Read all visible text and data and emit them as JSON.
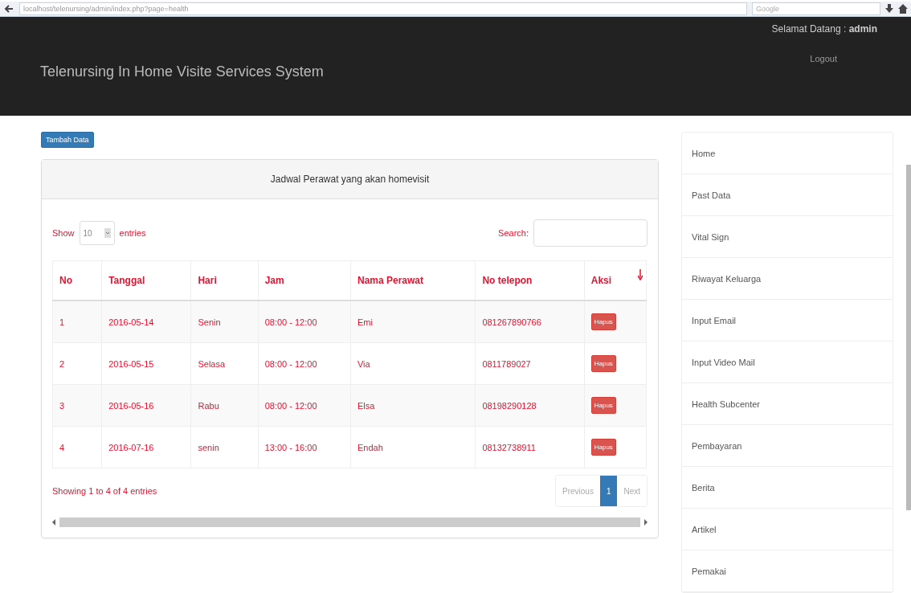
{
  "browser": {
    "url": "localhost/telenursing/admin/index.php?page=health",
    "search_placeholder": "Google"
  },
  "navbar": {
    "brand": "Telenursing In Home Visite Services System",
    "greeting": "Selamat Datang :",
    "user": "admin",
    "logout": "Logout"
  },
  "add_button": "Tambah Data",
  "panel": {
    "title": "Jadwal Perawat yang akan homevisit",
    "length": {
      "show": "Show",
      "value": "10",
      "entries": "entries"
    },
    "search": {
      "label": "Search:"
    },
    "table": {
      "columns": [
        "No",
        "Tanggal",
        "Hari",
        "Jam",
        "Nama Perawat",
        "No telepon",
        "Aksi"
      ],
      "rows": [
        {
          "cells": [
            "1",
            "2016-05-14",
            "Senin",
            "08:00 - 12:00",
            "Emi",
            "081267890766"
          ],
          "action": "Hapus"
        },
        {
          "cells": [
            "2",
            "2016-05-15",
            "Selasa",
            "08:00 - 12:00",
            "Via",
            "0811789027"
          ],
          "action": "Hapus"
        },
        {
          "cells": [
            "3",
            "2016-05-16",
            "Rabu",
            "08:00 - 12:00",
            "Elsa",
            "08198290128"
          ],
          "action": "Hapus"
        },
        {
          "cells": [
            "4",
            "2016-07-16",
            "senin",
            "13:00 - 16:00",
            "Endah",
            "08132738911"
          ],
          "action": "Hapus"
        }
      ]
    },
    "info": "Showing 1 to 4 of 4 entries",
    "pagination": [
      {
        "label": "Previous",
        "selected": false
      },
      {
        "label": "1",
        "selected": true
      },
      {
        "label": "Next",
        "selected": false
      }
    ]
  },
  "sidebar": {
    "items": [
      "Home",
      "Past Data",
      "Vital Sign",
      "Riwayat Keluarga",
      "Input Email",
      "Input Video Mail",
      "Health Subcenter",
      "Pembayaran",
      "Berita",
      "Artikel",
      "Pemakai"
    ]
  }
}
